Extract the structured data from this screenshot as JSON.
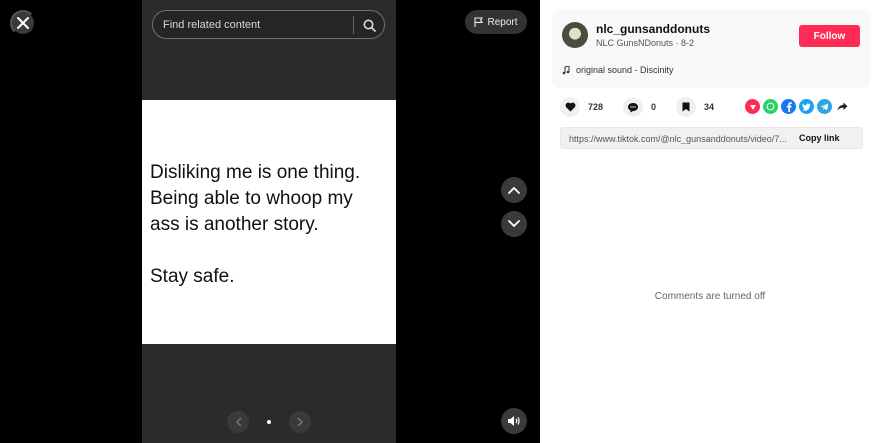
{
  "search": {
    "placeholder": "Find related content"
  },
  "toolbar": {
    "report_label": "Report"
  },
  "post": {
    "text": "Disliking me is one thing.\nBeing able to whoop my\nass is another story.\n\nStay safe."
  },
  "author": {
    "username": "nlc_gunsanddonuts",
    "display_and_date": "NLC GunsNDonuts · 8-2",
    "follow_label": "Follow",
    "music": "original sound - Discinity"
  },
  "stats": {
    "likes": "728",
    "comments": "0",
    "saves": "34"
  },
  "link": {
    "url": "https://www.tiktok.com/@nlc_gunsanddonuts/video/7...",
    "copy_label": "Copy link"
  },
  "comments": {
    "status": "Comments are turned off"
  },
  "share_icons": [
    "repost-icon",
    "whatsapp-icon",
    "facebook-icon",
    "twitter-icon",
    "telegram-icon",
    "share-arrow-icon"
  ],
  "colors": {
    "follow": "#fe2c55",
    "repost": "#fe2c55",
    "whatsapp": "#25d366",
    "facebook": "#1877f2",
    "twitter": "#1da1f2",
    "telegram": "#2ca5e0"
  }
}
